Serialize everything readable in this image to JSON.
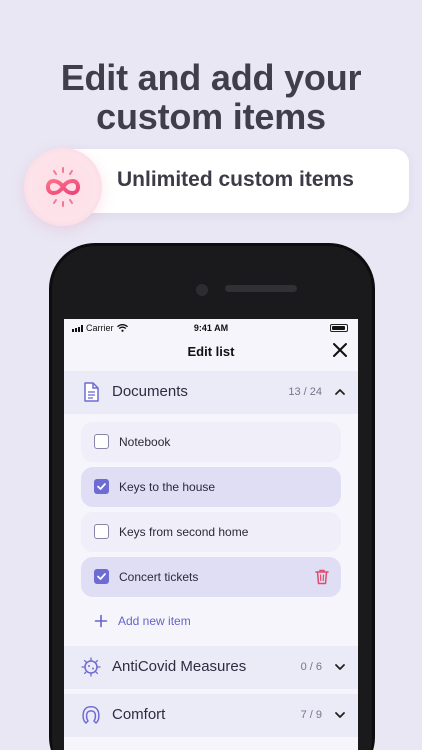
{
  "headline": {
    "line1": "Edit and add your",
    "line2": "custom items"
  },
  "banner": {
    "text": "Unlimited custom items",
    "icon": "infinity-icon"
  },
  "status_bar": {
    "carrier": "Carrier",
    "time": "9:41 AM"
  },
  "nav": {
    "title": "Edit list",
    "close_icon": "close-icon"
  },
  "sections": [
    {
      "title": "Documents",
      "count": "13 / 24",
      "icon": "document-icon",
      "expanded": true,
      "items": [
        {
          "label": "Notebook",
          "checked": false
        },
        {
          "label": "Keys to the house",
          "checked": true
        },
        {
          "label": "Keys from second home",
          "checked": false
        },
        {
          "label": "Concert tickets",
          "checked": true,
          "deletable": true
        }
      ],
      "add_label": "Add new item"
    },
    {
      "title": "AntiCovid Measures",
      "count": "0 / 6",
      "icon": "virus-icon",
      "expanded": false
    },
    {
      "title": "Comfort",
      "count": "7 / 9",
      "icon": "neck-pillow-icon",
      "expanded": false
    }
  ],
  "colors": {
    "background": "#e9e7f4",
    "accent": "#6e6cd2",
    "danger": "#e24b6a",
    "section_bg": "#ebeaf7"
  }
}
